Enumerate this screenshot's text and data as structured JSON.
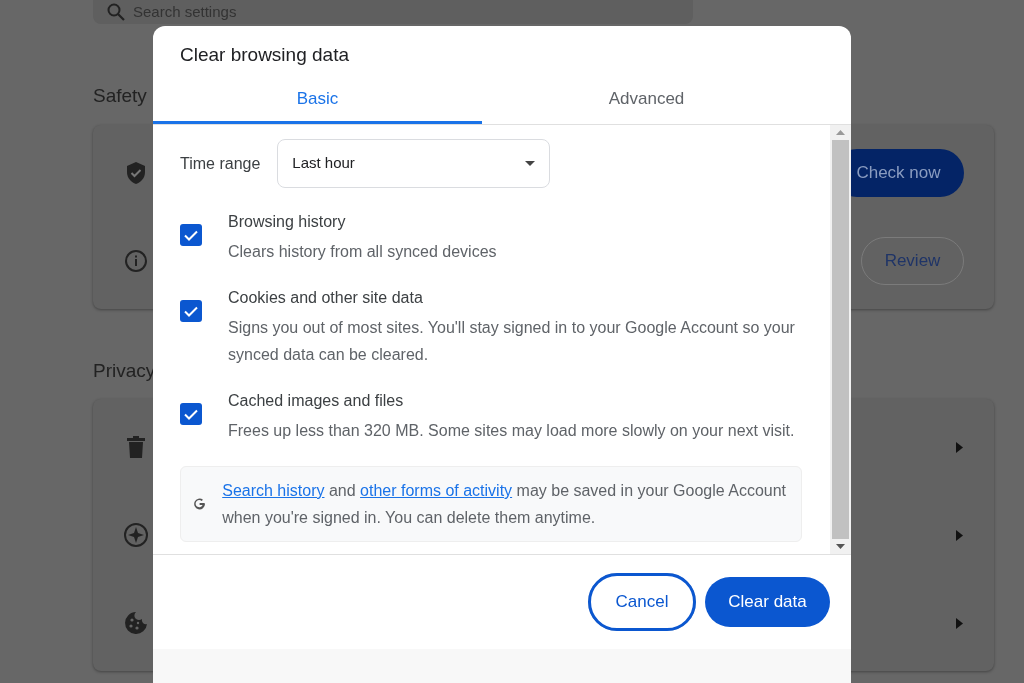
{
  "background": {
    "search": {
      "placeholder": "Search settings"
    },
    "sections": [
      {
        "title": "Safety",
        "rows": [
          {
            "kind": "action",
            "button": {
              "label": "Check now",
              "kind": "primary"
            }
          },
          {
            "kind": "action",
            "button": {
              "label": "Review",
              "kind": "outline"
            }
          }
        ]
      },
      {
        "title": "Privacy",
        "rows": [
          {
            "kind": "link"
          },
          {
            "kind": "link"
          },
          {
            "kind": "link"
          }
        ]
      }
    ]
  },
  "dialog": {
    "title": "Clear browsing data",
    "tabs": [
      {
        "label": "Basic",
        "selected": true
      },
      {
        "label": "Advanced",
        "selected": false
      }
    ],
    "time_range": {
      "label": "Time range",
      "value": "Last hour"
    },
    "options": [
      {
        "title": "Browsing history",
        "description": "Clears history from all synced devices",
        "checked": true
      },
      {
        "title": "Cookies and other site data",
        "description": "Signs you out of most sites. You'll stay signed in to your Google Account so your synced data can be cleared.",
        "checked": true
      },
      {
        "title": "Cached images and files",
        "description": "Frees up less than 320 MB. Some sites may load more slowly on your next visit.",
        "checked": true
      }
    ],
    "notice": {
      "parts": [
        {
          "kind": "link",
          "text": "Search history"
        },
        {
          "kind": "text",
          "text": " and "
        },
        {
          "kind": "link",
          "text": "other forms of activity"
        },
        {
          "kind": "text",
          "text": " may be saved in your Google Account when you're signed in. You can delete them anytime."
        }
      ]
    },
    "buttons": [
      {
        "label": "Cancel",
        "kind": "secondary",
        "focused": true
      },
      {
        "label": "Clear data",
        "kind": "primary",
        "focused": false
      }
    ]
  }
}
